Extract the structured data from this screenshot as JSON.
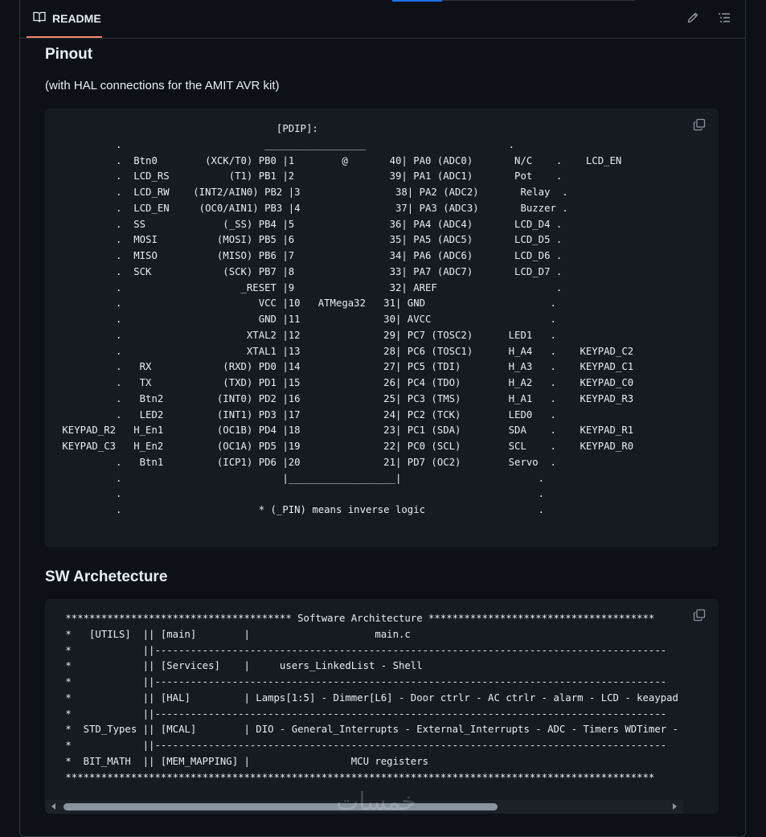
{
  "header": {
    "tab_label": "README"
  },
  "icons": {
    "readme": "book-icon",
    "edit": "pencil-icon",
    "outline": "list-icon",
    "copy": "copy-icon"
  },
  "pinout": {
    "heading": "Pinout",
    "subtitle": "(with HAL connections for the AMIT AVR kit)",
    "code": "                                     [PDIP]:\n          .                        _________________                        .\n          .  Btn0        (XCK/T0) PB0 |1        @       40| PA0 (ADC0)       N/C    .    LCD_EN\n          .  LCD_RS          (T1) PB1 |2                39| PA1 (ADC1)       Pot    .\n          .  LCD_RW    (INT2/AIN0) PB2 |3                38| PA2 (ADC2)       Relay  .\n          .  LCD_EN     (OC0/AIN1) PB3 |4                37| PA3 (ADC3)       Buzzer .\n          .  SS             (_SS) PB4 |5                36| PA4 (ADC4)       LCD_D4 .\n          .  MOSI          (MOSI) PB5 |6                35| PA5 (ADC5)       LCD_D5 .\n          .  MISO          (MISO) PB6 |7                34| PA6 (ADC6)       LCD_D6 .\n          .  SCK            (SCK) PB7 |8                33| PA7 (ADC7)       LCD_D7 .\n          .                    _RESET |9                32| AREF                    .\n          .                       VCC |10   ATMega32   31| GND                     .\n          .                       GND |11              30| AVCC                    .\n          .                     XTAL2 |12              29| PC7 (TOSC2)      LED1   .\n          .                     XTAL1 |13              28| PC6 (TOSC1)      H_A4   .    KEYPAD_C2\n          .   RX            (RXD) PD0 |14              27| PC5 (TDI)        H_A3   .    KEYPAD_C1\n          .   TX            (TXD) PD1 |15              26| PC4 (TDO)        H_A2   .    KEYPAD_C0\n          .   Btn2         (INT0) PD2 |16              25| PC3 (TMS)        H_A1   .    KEYPAD_R3\n          .   LED2         (INT1) PD3 |17              24| PC2 (TCK)        LED0   .\n KEYPAD_R2   H_En1         (OC1B) PD4 |18              23| PC1 (SDA)        SDA    .    KEYPAD_R1\n KEYPAD_C3   H_En2         (OC1A) PD5 |19              22| PC0 (SCL)        SCL    .    KEYPAD_R0\n          .   Btn1         (ICP1) PD6 |20              21| PD7 (OC2)        Servo  .\n          .                           |__________________|                       .\n          .                                                                      .\n          .                       * (_PIN) means inverse logic                   ."
  },
  "architecture": {
    "heading": "SW Archetecture",
    "code": " ************************************** Software Architecture **************************************\n *   [UTILS]  || [main]        |                     main.c\n *            ||--------------------------------------------------------------------------------------\n *            || [Services]    |     users_LinkedList - Shell\n *            ||--------------------------------------------------------------------------------------\n *            || [HAL]         | Lamps[1:5] - Dimmer[L6] - Door ctrlr - AC ctrlr - alarm - LCD - keaypad\n *            ||--------------------------------------------------------------------------------------\n *  STD_Types || [MCAL]        | DIO - General_Interrupts - External_Interrupts - ADC - Timers WDTimer -\n *            ||--------------------------------------------------------------------------------------\n *  BIT_MATH  || [MEM_MAPPING] |                 MCU registers\n ***************************************************************************************************"
  },
  "scrollbar": {
    "position": 0.0,
    "visible_fraction": 0.68
  },
  "watermark": "خمسات",
  "colors": {
    "background": "#0d1117",
    "code_bg": "#161b22",
    "border": "#30363d",
    "tab_underline": "#f78166",
    "text": "#e6edf3",
    "muted": "#8b949e"
  }
}
